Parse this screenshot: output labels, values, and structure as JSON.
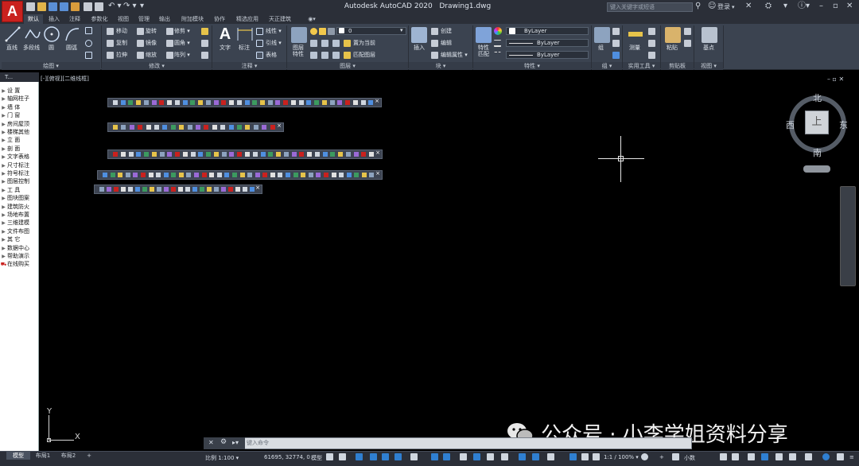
{
  "app": {
    "logo": "A",
    "title": "Autodesk AutoCAD 2020",
    "document": "Drawing1.dwg"
  },
  "titlebar": {
    "search_placeholder": "键入关键字或短语",
    "login": "登录"
  },
  "tabs": [
    "默认",
    "插入",
    "注释",
    "参数化",
    "视图",
    "管理",
    "输出",
    "附加模块",
    "协作",
    "精选应用",
    "天正建筑"
  ],
  "ribbon": {
    "draw": {
      "title": "绘图 ▾",
      "line": "直线",
      "polyline": "多段线",
      "circle": "圆",
      "arc": "圆弧"
    },
    "modify": {
      "title": "修改 ▾",
      "move": "移动",
      "rotate": "旋转",
      "trim": "修剪 ▾",
      "copy": "复制",
      "mirror": "镜像",
      "fillet": "圆角 ▾",
      "stretch": "拉伸",
      "scale": "缩放",
      "array": "阵列 ▾"
    },
    "annotation": {
      "title": "注释 ▾",
      "text": "文字",
      "dimension": "标注",
      "linear": "线性 ▾",
      "leader": "引线 ▾",
      "table": "表格"
    },
    "layers": {
      "title": "图层 ▾",
      "layer_props": "图层特性",
      "current_layer": "0",
      "set_current": "置为当前",
      "match_layer": "匹配图层"
    },
    "block": {
      "title": "块 ▾",
      "insert": "插入",
      "create": "创建",
      "edit": "编辑",
      "edit_attr": "编辑属性 ▾"
    },
    "properties": {
      "title": "特性 ▾",
      "match": "特性匹配",
      "color": "ByLayer",
      "linetype": "ByLayer",
      "lineweight": "ByLayer"
    },
    "groups": {
      "title": "组 ▾",
      "group": "组"
    },
    "utilities": {
      "title": "实用工具 ▾",
      "measure": "测量"
    },
    "clipboard": {
      "title": "剪贴板",
      "paste": "粘贴"
    },
    "view": {
      "title": "视图 ▾",
      "base": "基点"
    }
  },
  "palette": {
    "header": "T...",
    "items": [
      "设  置",
      "轴网柱子",
      "墙  体",
      "门  窗",
      "房间屋顶",
      "楼梯其他",
      "立  面",
      "剖  面",
      "文字表格",
      "尺寸标注",
      "符号标注",
      "图层控制",
      "工  具",
      "图块图案",
      "建筑防火",
      "场地布置",
      "三维建模",
      "文件布图",
      "其  它",
      "数据中心",
      "帮助演示",
      "在线购买"
    ]
  },
  "viewport": {
    "label": "[-][俯视][二维线框]",
    "compass": {
      "north": "北",
      "south": "南",
      "east": "东",
      "west": "西",
      "face": "上"
    },
    "ucs_x": "X",
    "ucs_y": "Y"
  },
  "watermark": "公众号 · 小李学姐资料分享",
  "command": {
    "placeholder": "键入命令"
  },
  "layout_tabs": [
    "模型",
    "布局1",
    "布局2",
    "+"
  ],
  "status": {
    "scale": "比例 1:100 ▾",
    "coords": "61695, 32774, 0",
    "model": "模型",
    "annoscale": "1:1 / 100% ▾",
    "units": "小数"
  },
  "colors": {
    "accent": "#2f7fd1",
    "logo": "#c9211e",
    "ribbon": "#3b4350",
    "titlebar": "#2b2f38"
  }
}
